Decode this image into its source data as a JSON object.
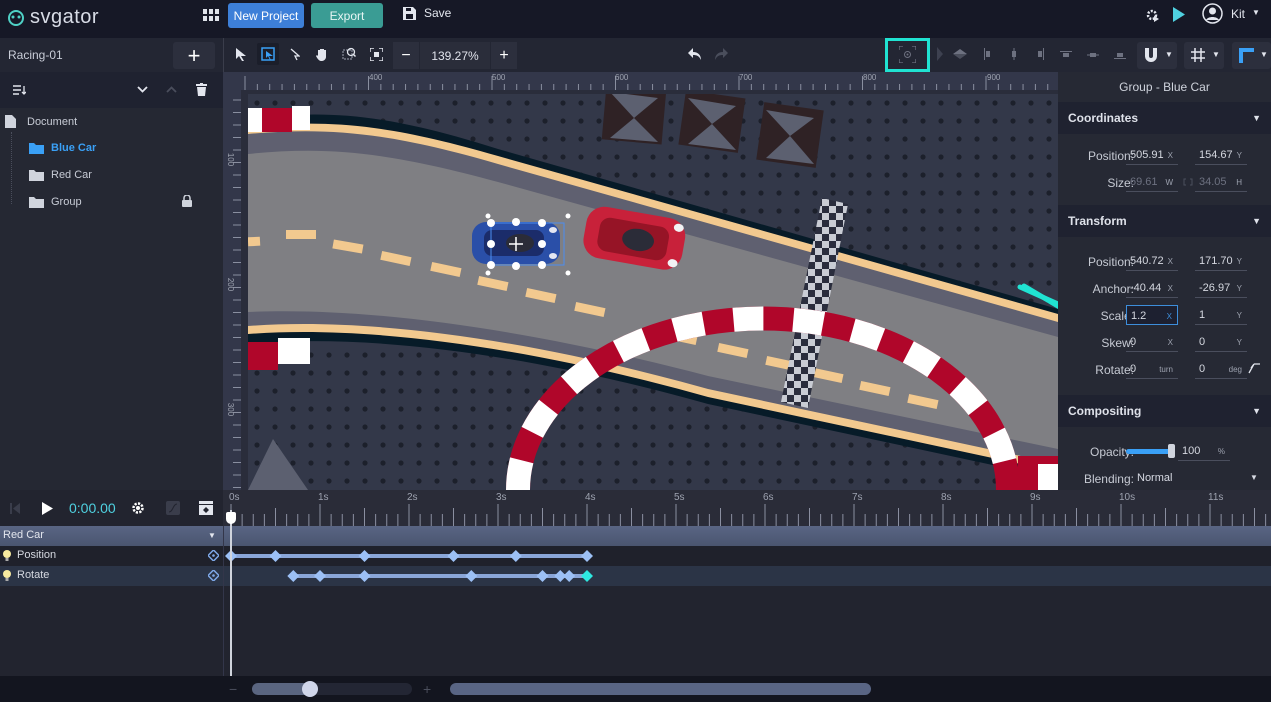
{
  "app": {
    "name": "svgator"
  },
  "topbar": {
    "new_project_label": "New Project",
    "export_label": "Export",
    "save_label": "Save",
    "user_name": "Kit",
    "colors": {
      "new_project": "#3d7fd8",
      "export": "#3a9c94",
      "accent": "#4fd1c5"
    }
  },
  "toolbar": {
    "project_name": "Racing-01",
    "zoom_level": "139.27%",
    "tools": [
      "select-tool",
      "node-select-tool",
      "pen-tool",
      "hand-tool",
      "zoom-tool",
      "fit-tool"
    ],
    "active_tool": "node-select-tool"
  },
  "layers": {
    "root": "Document",
    "items": [
      {
        "label": "Blue Car",
        "selected": true,
        "locked": false
      },
      {
        "label": "Red Car",
        "selected": false,
        "locked": false
      },
      {
        "label": "Group",
        "selected": false,
        "locked": true
      }
    ]
  },
  "ruler": {
    "h_labels": [
      "400",
      "500",
      "600",
      "700",
      "800",
      "900"
    ],
    "v_labels": [
      "100",
      "200",
      "300"
    ]
  },
  "inspector": {
    "title": "Group - Blue Car",
    "coordinates": {
      "heading": "Coordinates",
      "position_label": "Position:",
      "position_x": "505.91",
      "position_y": "154.67",
      "size_label": "Size:",
      "size_w": "69.61",
      "size_h": "34.05"
    },
    "transform": {
      "heading": "Transform",
      "position_label": "Position:",
      "position_x": "540.72",
      "position_y": "171.70",
      "anchor_label": "Anchor:",
      "anchor_x": "-40.44",
      "anchor_y": "-26.97",
      "scale_label": "Scale:",
      "scale_x": "1.2",
      "scale_y": "1",
      "skew_label": "Skew:",
      "skew_x": "0",
      "skew_y": "0",
      "rotate_label": "Rotate:",
      "rotate_turn": "0",
      "rotate_deg": "0"
    },
    "compositing": {
      "heading": "Compositing",
      "opacity_label": "Opacity:",
      "opacity": "100",
      "opacity_fraction": 1.0,
      "blending_label": "Blending:",
      "blending": "Normal"
    },
    "units": {
      "x": "X",
      "y": "Y",
      "w": "W",
      "h": "H",
      "turn": "turn",
      "deg": "deg",
      "pct": "%"
    }
  },
  "timeline": {
    "current_time": "0:00.00",
    "ticks": [
      "0s",
      "1s",
      "2s",
      "3s",
      "4s",
      "5s",
      "6s",
      "7s",
      "8s",
      "9s",
      "10s",
      "11s"
    ],
    "group": "Red Car",
    "tracks": [
      {
        "name": "Position",
        "keyframes_s": [
          0,
          0.5,
          1.5,
          2.5,
          3.2,
          4.0
        ]
      },
      {
        "name": "Rotate",
        "keyframes_s": [
          0.7,
          1.0,
          1.5,
          2.7,
          3.5,
          3.7,
          3.8,
          4.0
        ],
        "selected_keyframe_s": 4.0
      }
    ],
    "zoom_slider_fraction": 0.36
  }
}
